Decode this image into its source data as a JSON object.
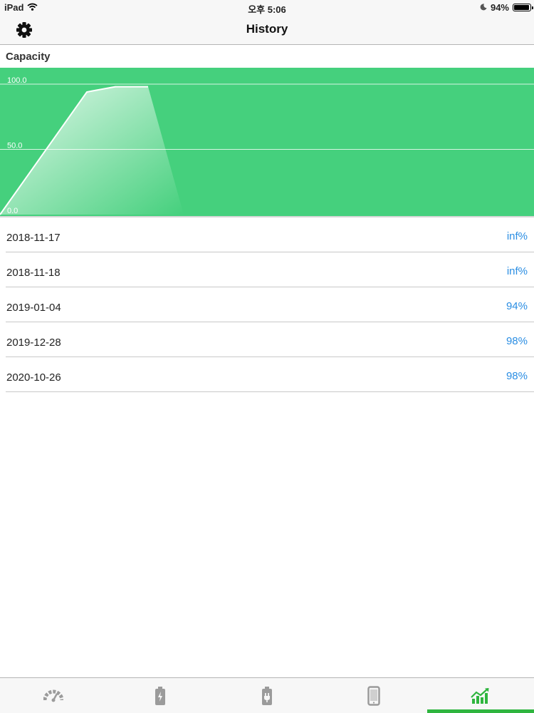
{
  "status_bar": {
    "device": "iPad",
    "time": "오후 5:06",
    "battery": "94%",
    "battery_level": 0.94
  },
  "nav": {
    "title": "History"
  },
  "section": {
    "title": "Capacity"
  },
  "chart_data": {
    "type": "area",
    "title": "",
    "xlabel": "",
    "ylabel": "",
    "ylim": [
      0,
      100
    ],
    "yticks": [
      "100.0",
      "50.0",
      "0.0"
    ],
    "ytick_values": [
      100,
      50,
      0
    ],
    "x": [
      "2018-11-17",
      "2018-11-18",
      "2019-01-04",
      "2019-12-28",
      "2020-10-26"
    ],
    "values": [
      0,
      94,
      98,
      98,
      0
    ],
    "grid": true,
    "legend": "none",
    "colors": {
      "background": "#45d07d",
      "line": "#ffffff",
      "grid": "#d8f5e3"
    }
  },
  "history": [
    {
      "date": "2018-11-17",
      "value": "inf%"
    },
    {
      "date": "2018-11-18",
      "value": "inf%"
    },
    {
      "date": "2019-01-04",
      "value": "94%"
    },
    {
      "date": "2019-12-28",
      "value": "98%"
    },
    {
      "date": "2020-10-26",
      "value": "98%"
    }
  ],
  "tabs": [
    {
      "name": "gauge-icon",
      "active": false
    },
    {
      "name": "battery-charging-icon",
      "active": false
    },
    {
      "name": "battery-plug-icon",
      "active": false
    },
    {
      "name": "tablet-icon",
      "active": false
    },
    {
      "name": "trend-chart-icon",
      "active": true
    }
  ],
  "colors": {
    "accent": "#2fb53f",
    "value_text": "#2b8ee3",
    "icon_inactive": "#9b9b9b"
  }
}
